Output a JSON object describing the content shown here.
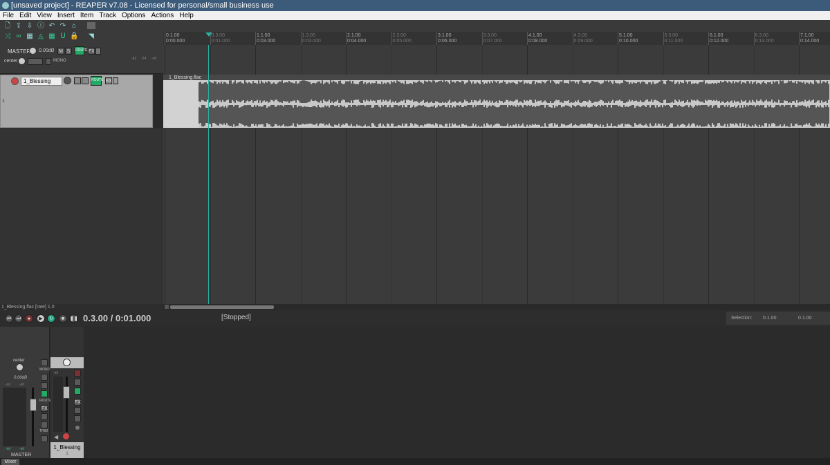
{
  "window": {
    "title": "[unsaved project] - REAPER v7.08 - Licensed for personal/small business use"
  },
  "menu": [
    "File",
    "Edit",
    "View",
    "Insert",
    "Item",
    "Track",
    "Options",
    "Actions",
    "Help"
  ],
  "master": {
    "name": "MASTER",
    "volume": "0.00dB",
    "pan": "center",
    "mono_label": "MONO",
    "route_label": "ROUTE",
    "fx_label": "FX",
    "m_label": "M",
    "s_label": "S",
    "meter_scale": [
      "-42",
      "-24",
      "-inf"
    ]
  },
  "track": {
    "number": "1",
    "name": "1_Blessing",
    "route_label": "ROUTE",
    "fx_label": "FX"
  },
  "ruler": {
    "marks": [
      {
        "bar": "0.1.00",
        "time": "0:00.000"
      },
      {
        "bar": "0.3.00",
        "time": "0:01.000"
      },
      {
        "bar": "1.1.00",
        "time": "0:03.000"
      },
      {
        "bar": "1.3.00",
        "time": "0:03.000"
      },
      {
        "bar": "2.1.00",
        "time": "0:04.000"
      },
      {
        "bar": "2.3.00",
        "time": "0:05.000"
      },
      {
        "bar": "3.1.00",
        "time": "0:06.000"
      },
      {
        "bar": "3.3.00",
        "time": "0:07.000"
      },
      {
        "bar": "4.1.00",
        "time": "0:08.000"
      },
      {
        "bar": "4.3.00",
        "time": "0:09.000"
      },
      {
        "bar": "5.1.00",
        "time": "0:10.000"
      },
      {
        "bar": "5.3.00",
        "time": "0:11.000"
      },
      {
        "bar": "6.1.00",
        "time": "0:12.000"
      },
      {
        "bar": "6.3.00",
        "time": "0:13.000"
      },
      {
        "bar": "7.1.00",
        "time": "0:14.000"
      }
    ]
  },
  "item": {
    "label": "1_Blessing.flac"
  },
  "status": {
    "item_info": "1_Blessing.flac [rate] 1.0"
  },
  "transport": {
    "time": "0.3.00 / 0:01.000",
    "state": "[Stopped]",
    "selection_label": "Selection:",
    "selection_start": "0.1.00",
    "selection_end": "0.1.00"
  },
  "mixer": {
    "master_pan": "center",
    "master_volume": "0.00dB",
    "master_label": "MASTER",
    "track_label": "1_Blessing",
    "track_number": "1",
    "mono_label": "MONO",
    "route_label": "ROUTE",
    "fx_label": "FX",
    "trim_label": "TRIM",
    "inf_label": "-inf",
    "tab_label": "Mixer"
  }
}
